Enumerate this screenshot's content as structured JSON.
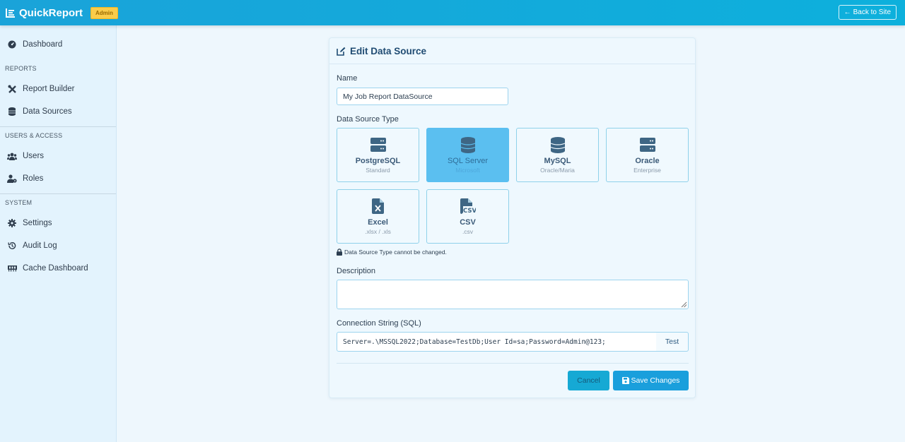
{
  "navbar": {
    "brand": "QuickReport",
    "badge": "Admin",
    "back_label": "Back to Site",
    "colors": {
      "bar": "#12a9da",
      "badge": "#facc4a"
    }
  },
  "sidebar": {
    "dashboard": "Dashboard",
    "sections": {
      "reports": "REPORTS",
      "users_access": "USERS & ACCESS",
      "system": "SYSTEM"
    },
    "items": {
      "report_builder": "Report Builder",
      "data_sources": "Data Sources",
      "users": "Users",
      "roles": "Roles",
      "settings": "Settings",
      "audit_log": "Audit Log",
      "cache_dashboard": "Cache Dashboard"
    }
  },
  "form": {
    "title": "Edit Data Source",
    "name_label": "Name",
    "name_value": "My Job Report DataSource",
    "type_label": "Data Source Type",
    "types": [
      {
        "name": "PostgreSQL",
        "sub": "Standard",
        "icon": "server-icon",
        "selected": false
      },
      {
        "name": "SQL Server",
        "sub": "Microsoft",
        "icon": "database-icon",
        "selected": true
      },
      {
        "name": "MySQL",
        "sub": "Oracle/Maria",
        "icon": "database-icon",
        "selected": false
      },
      {
        "name": "Oracle",
        "sub": "Enterprise",
        "icon": "server-icon",
        "selected": false
      },
      {
        "name": "Excel",
        "sub": ".xlsx / .xls",
        "icon": "excel-file-icon",
        "selected": false
      },
      {
        "name": "CSV",
        "sub": ".csv",
        "icon": "csv-file-icon",
        "selected": false
      }
    ],
    "type_note": "Data Source Type cannot be changed.",
    "description_label": "Description",
    "description_value": "",
    "conn_label": "Connection String (SQL)",
    "conn_value": "Server=.\\MSSQL2022;Database=TestDb;User Id=sa;Password=Admin@123;",
    "test_label": "Test",
    "cancel_label": "Cancel",
    "save_label": "Save Changes"
  }
}
